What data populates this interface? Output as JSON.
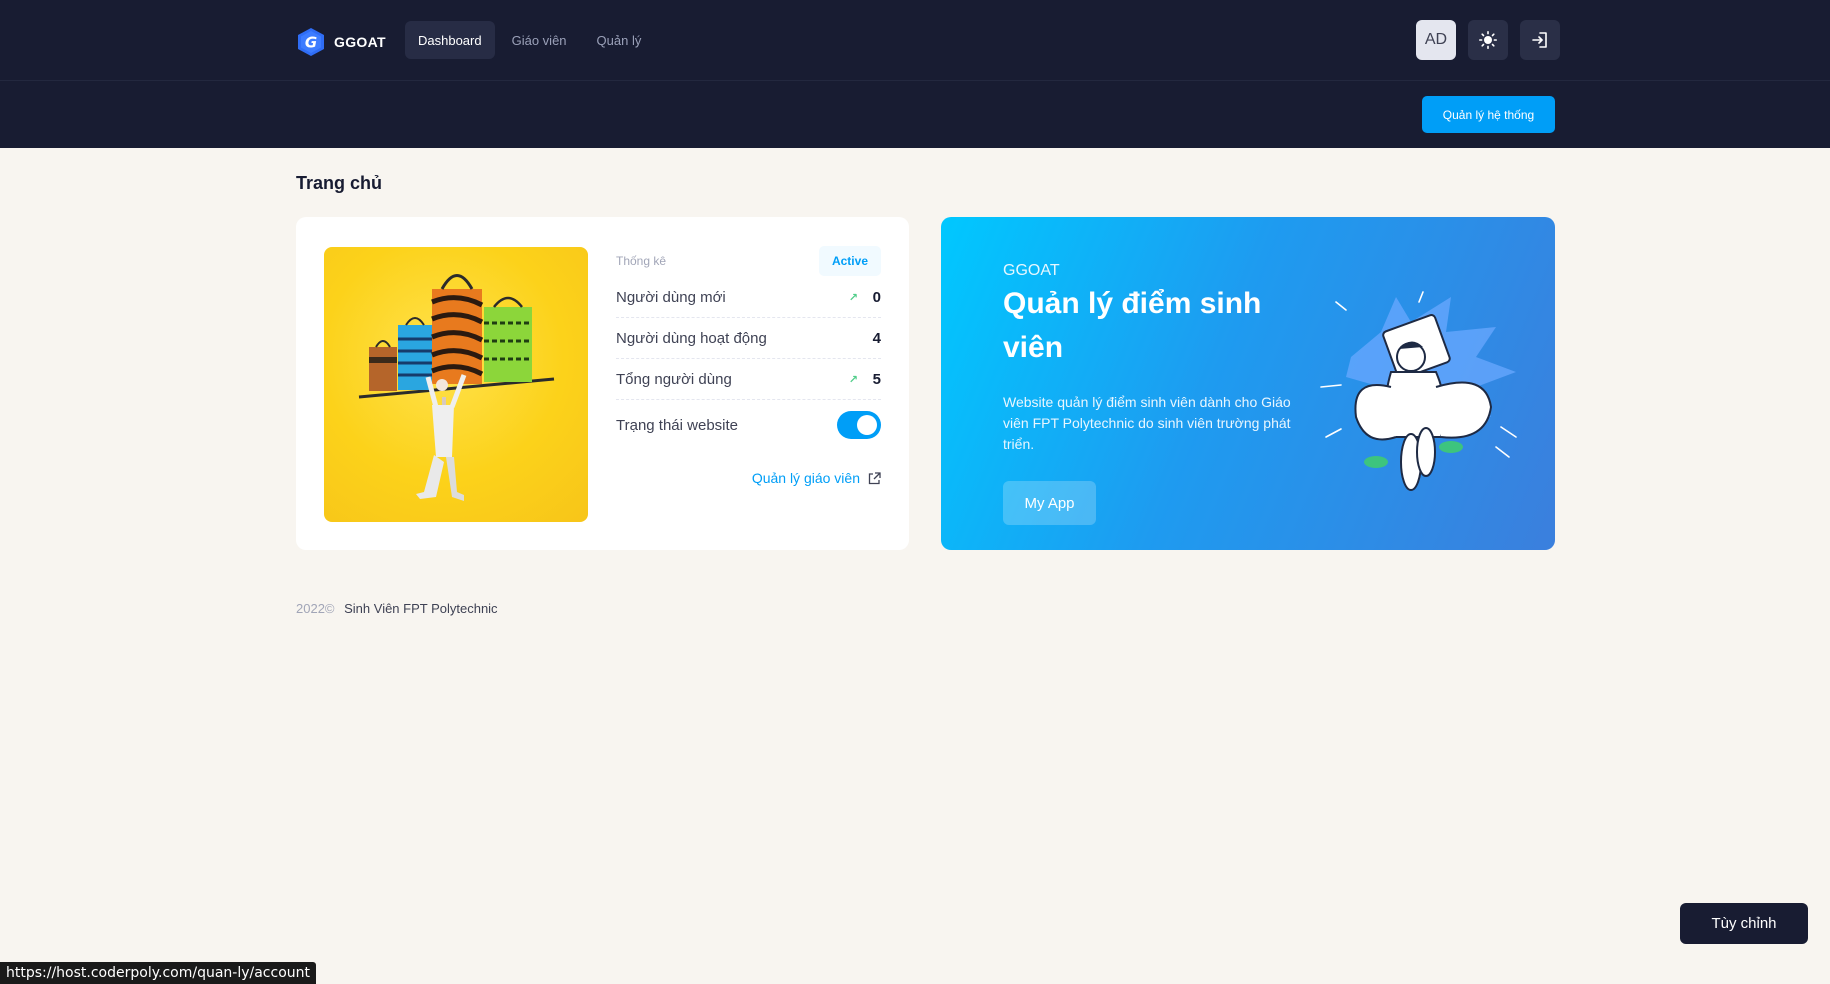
{
  "brand": {
    "name": "GGOAT",
    "logo_letter": "G"
  },
  "nav": [
    {
      "label": "Dashboard",
      "active": true
    },
    {
      "label": "Giáo viên",
      "active": false
    },
    {
      "label": "Quản lý",
      "active": false
    }
  ],
  "top_actions": {
    "avatar_initials": "AD",
    "theme_icon": "sun-icon",
    "logout_icon": "sign-out-icon"
  },
  "system_button": "Quản lý hệ thống",
  "page_title": "Trang chủ",
  "stats": {
    "label": "Thống kê",
    "badge": "Active",
    "rows": [
      {
        "label": "Người dùng mới",
        "value": "0",
        "trend": "up"
      },
      {
        "label": "Người dùng hoạt động",
        "value": "4",
        "trend": "none"
      },
      {
        "label": "Tổng người dùng",
        "value": "5",
        "trend": "up"
      }
    ],
    "website_status_label": "Trạng thái website",
    "website_status_on": true,
    "manage_link": "Quản lý giáo viên"
  },
  "hero": {
    "eyebrow": "GGOAT",
    "title": "Quản lý điểm sinh viên",
    "description": "Website quản lý điểm sinh viên dành cho Giáo viên FPT Polytechnic do sinh viên trường phát triển.",
    "button": "My App"
  },
  "footer": {
    "year": "2022©",
    "owner": "Sinh Viên FPT Polytechnic"
  },
  "customize_button": "Tùy chỉnh",
  "status_url": "https://host.coderpoly.com/quan-ly/account",
  "colors": {
    "header_bg": "#181c32",
    "primary": "#009ef7",
    "success": "#50cd89",
    "page_bg": "#f8f5f0"
  }
}
